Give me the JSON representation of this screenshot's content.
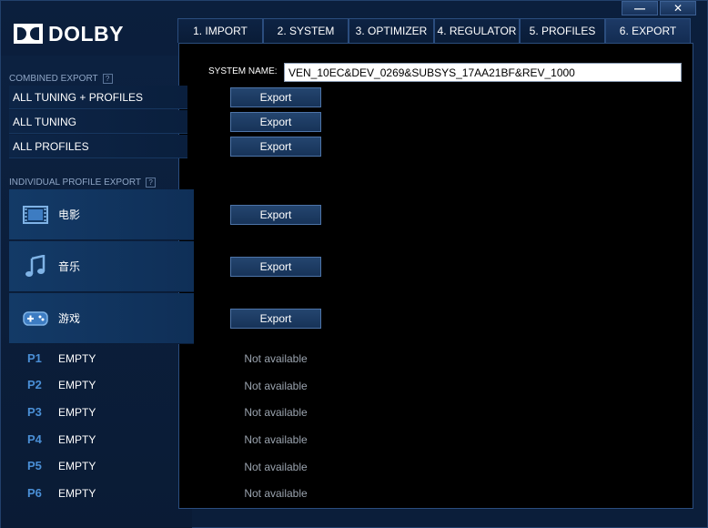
{
  "brand": {
    "logo_text": "DOLBY"
  },
  "window": {
    "minimize_glyph": "—",
    "close_glyph": "✕"
  },
  "tabs": [
    {
      "label": "1. IMPORT"
    },
    {
      "label": "2. SYSTEM"
    },
    {
      "label": "3. OPTIMIZER"
    },
    {
      "label": "4. REGULATOR"
    },
    {
      "label": "5. PROFILES"
    },
    {
      "label": "6. EXPORT",
      "active": true
    }
  ],
  "system": {
    "label": "SYSTEM NAME:",
    "value": "VEN_10EC&DEV_0269&SUBSYS_17AA21BF&REV_1000"
  },
  "combined_export": {
    "title": "COMBINED EXPORT",
    "help": "?",
    "items": [
      {
        "label": "ALL TUNING + PROFILES",
        "button": "Export"
      },
      {
        "label": "ALL TUNING",
        "button": "Export"
      },
      {
        "label": "ALL PROFILES",
        "button": "Export"
      }
    ]
  },
  "individual_export": {
    "title": "INDIVIDUAL PROFILE EXPORT",
    "help": "?",
    "profiles": [
      {
        "label": "电影",
        "icon": "film-icon",
        "button": "Export"
      },
      {
        "label": "音乐",
        "icon": "music-note-icon",
        "button": "Export"
      },
      {
        "label": "游戏",
        "icon": "gamepad-icon",
        "button": "Export"
      }
    ],
    "slots": [
      {
        "num": "P1",
        "label": "EMPTY",
        "status": "Not available"
      },
      {
        "num": "P2",
        "label": "EMPTY",
        "status": "Not available"
      },
      {
        "num": "P3",
        "label": "EMPTY",
        "status": "Not available"
      },
      {
        "num": "P4",
        "label": "EMPTY",
        "status": "Not available"
      },
      {
        "num": "P5",
        "label": "EMPTY",
        "status": "Not available"
      },
      {
        "num": "P6",
        "label": "EMPTY",
        "status": "Not available"
      }
    ]
  },
  "colors": {
    "accent_blue": "#4a8fd6",
    "panel_bg": "#000000",
    "app_bg": "#0b1f3d"
  }
}
